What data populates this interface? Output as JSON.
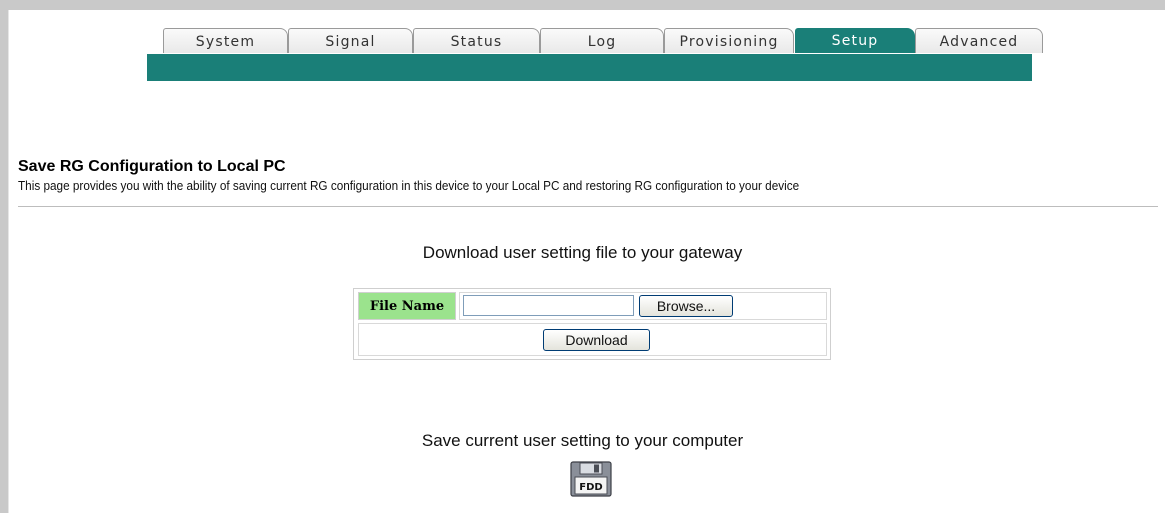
{
  "tabs": [
    {
      "label": "System",
      "active": false
    },
    {
      "label": "Signal",
      "active": false
    },
    {
      "label": "Status",
      "active": false
    },
    {
      "label": "Log",
      "active": false
    },
    {
      "label": "Provisioning",
      "active": false
    },
    {
      "label": "Setup",
      "active": true
    },
    {
      "label": "Advanced",
      "active": false
    }
  ],
  "page": {
    "title": "Save RG Configuration to Local PC",
    "description": "This page provides you with the ability of saving current RG configuration in this device to your Local PC and restoring RG configuration to your device"
  },
  "download_section": {
    "heading": "Download user setting file to your gateway",
    "file_label": "File Name",
    "file_value": "",
    "browse_label": "Browse...",
    "download_label": "Download"
  },
  "save_section": {
    "heading": "Save current user setting to your computer",
    "icon": "floppy-disk-icon",
    "icon_text": "FDD"
  },
  "colors": {
    "accent": "#1a7f78",
    "label_green": "#9be38d"
  }
}
